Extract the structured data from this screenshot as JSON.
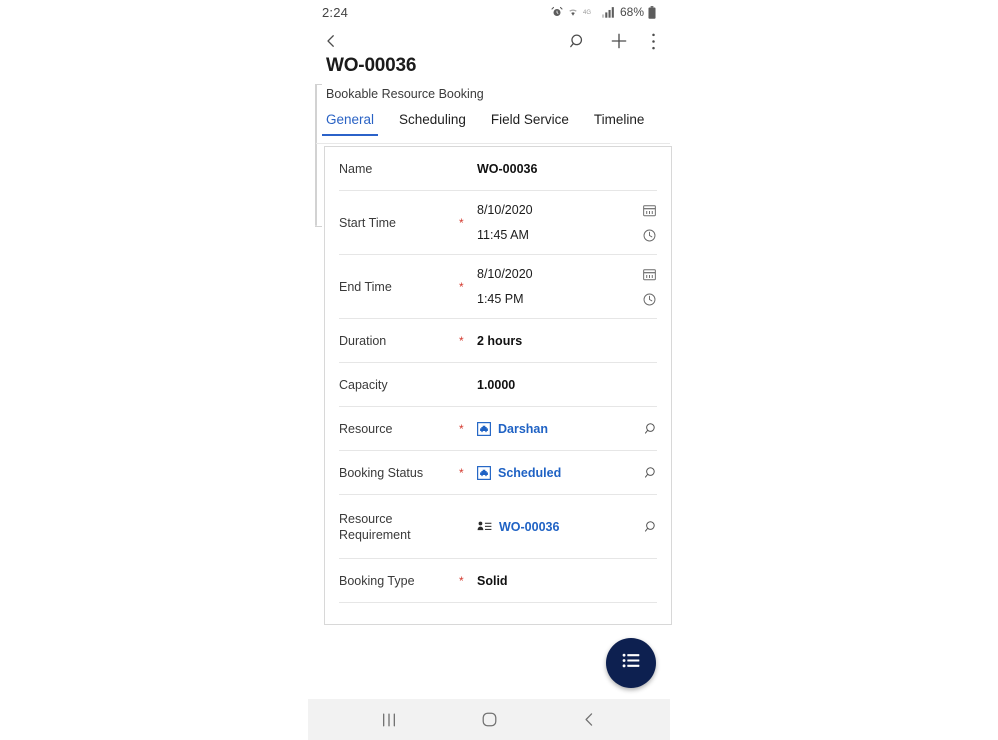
{
  "status_bar": {
    "clock": "2:24",
    "battery_percent": "68%",
    "icons": [
      "alarm-icon",
      "wifi-icon",
      "lte-4g-icon",
      "signal-bars-icon",
      "battery-icon"
    ],
    "network_label": "4G"
  },
  "app_bar": {
    "back_label": "Back",
    "actions": [
      "search-icon",
      "plus-icon",
      "more-vertical-icon"
    ]
  },
  "record": {
    "title": "WO-00036",
    "subtitle": "Bookable Resource Booking"
  },
  "tabs": [
    {
      "label": "General",
      "active": true
    },
    {
      "label": "Scheduling",
      "active": false
    },
    {
      "label": "Field Service",
      "active": false
    },
    {
      "label": "Timeline",
      "active": false
    }
  ],
  "form": {
    "fields": [
      {
        "type": "text",
        "label": "Name",
        "required": false,
        "value": "WO-00036"
      },
      {
        "type": "datetime",
        "label": "Start Time",
        "required": true,
        "date": "8/10/2020",
        "time": "11:45 AM"
      },
      {
        "type": "datetime",
        "label": "End Time",
        "required": true,
        "date": "8/10/2020",
        "time": "1:45 PM"
      },
      {
        "type": "text",
        "label": "Duration",
        "required": true,
        "value": "2 hours"
      },
      {
        "type": "text",
        "label": "Capacity",
        "required": false,
        "value": "1.0000"
      },
      {
        "type": "lookup",
        "label": "Resource",
        "required": true,
        "value": "Darshan",
        "entity_icon": "bookable-resource-icon"
      },
      {
        "type": "lookup",
        "label": "Booking Status",
        "required": true,
        "value": "Scheduled",
        "entity_icon": "booking-status-icon"
      },
      {
        "type": "lookup",
        "label": "Resource Requirement",
        "required": false,
        "value": "WO-00036",
        "entity_icon": "resource-requirement-icon"
      },
      {
        "type": "text",
        "label": "Booking Type",
        "required": true,
        "value": "Solid"
      }
    ],
    "required_marker": "*"
  },
  "fab": {
    "icon": "list-menu-icon",
    "label": "Menu"
  },
  "nav_bar": {
    "recents_label": "Recents",
    "home_label": "Home",
    "back_label": "Back"
  },
  "colors": {
    "accent_blue": "#2b62c9",
    "link_blue": "#1f62c4",
    "required_red": "#d43a2f",
    "fab_navy": "#0d2050",
    "divider": "#e6e6e6",
    "card_border": "#d8d8d8",
    "nav_bar_bg": "#f2f2f2"
  }
}
